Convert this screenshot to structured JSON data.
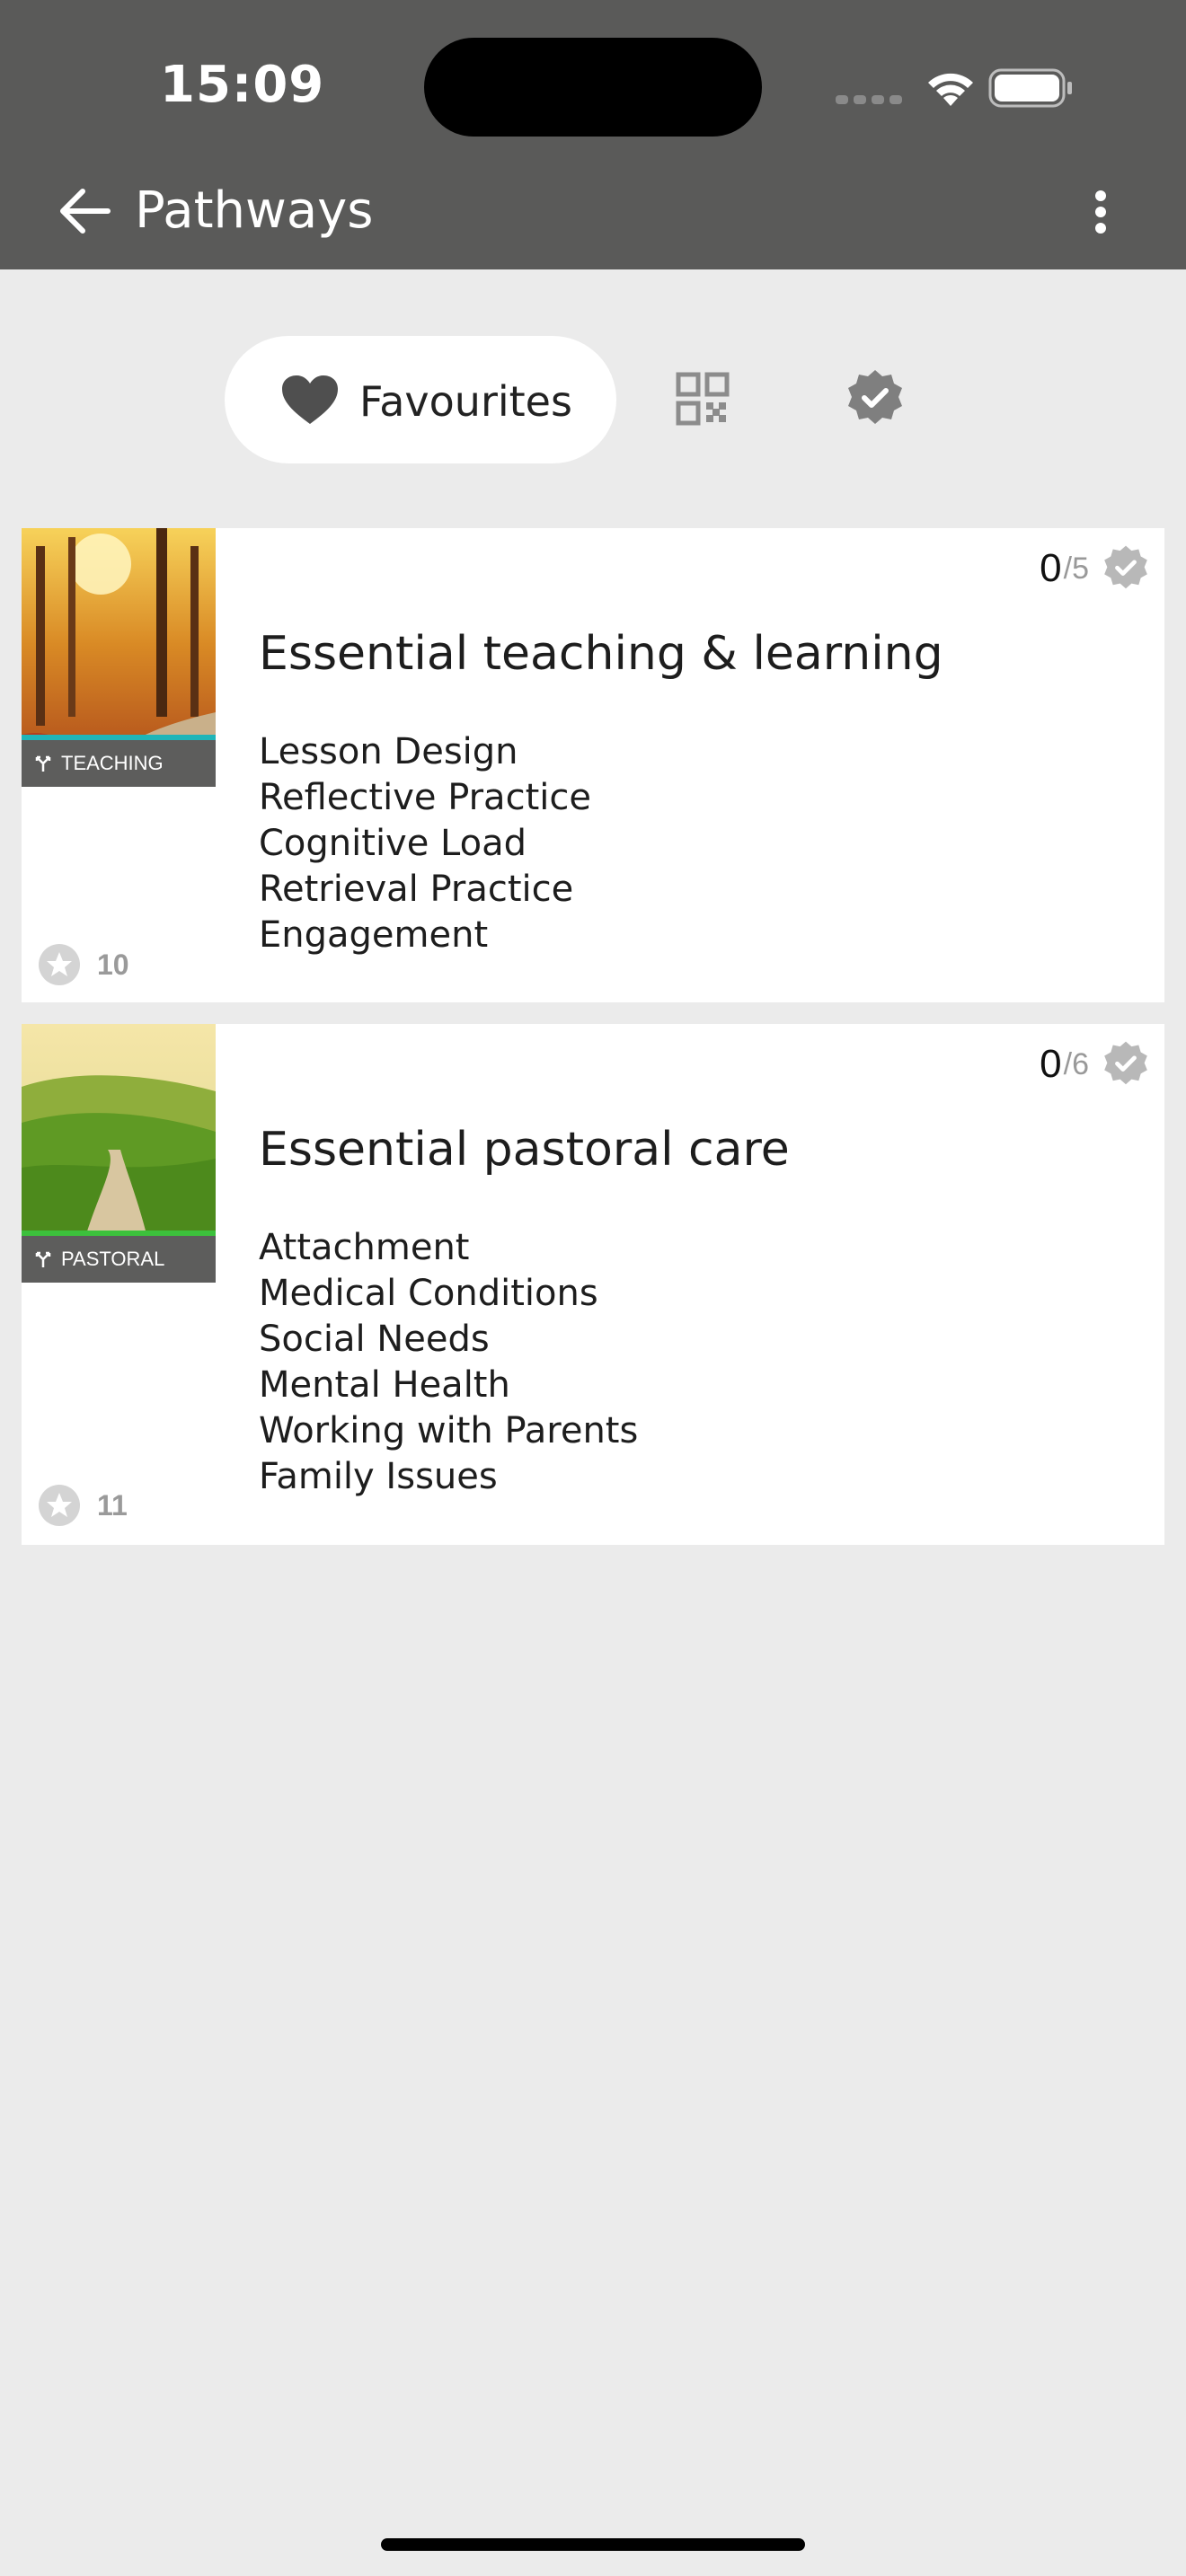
{
  "status_bar": {
    "time": "15:09"
  },
  "app_bar": {
    "title": "Pathways"
  },
  "filters": {
    "favourites_label": "Favourites"
  },
  "colors": {
    "app_bar_bg": "#5a5a59",
    "page_bg": "#ebebeb",
    "teaching_accent": "#1fb5b8",
    "pastoral_accent": "#3cc13c",
    "muted_icon": "#8c8c8c"
  },
  "icons": {
    "back": "arrow-left-icon",
    "more": "more-vertical-icon",
    "favourites": "heart-icon",
    "qr": "qr-code-icon",
    "verified": "verified-badge-icon",
    "category": "branch-icon",
    "rating": "star-icon"
  },
  "pathways": [
    {
      "title": "Essential teaching & learning",
      "category": "TEACHING",
      "completed": "0",
      "total": "5",
      "rating_count": "10",
      "topics": [
        "Lesson Design",
        "Reflective Practice",
        "Cognitive Load",
        "Retrieval Practice",
        "Engagement"
      ]
    },
    {
      "title": "Essential pastoral care",
      "category": "PASTORAL",
      "completed": "0",
      "total": "6",
      "rating_count": "11",
      "topics": [
        "Attachment",
        "Medical Conditions",
        "Social Needs",
        "Mental Health",
        "Working with Parents",
        "Family Issues"
      ]
    }
  ]
}
